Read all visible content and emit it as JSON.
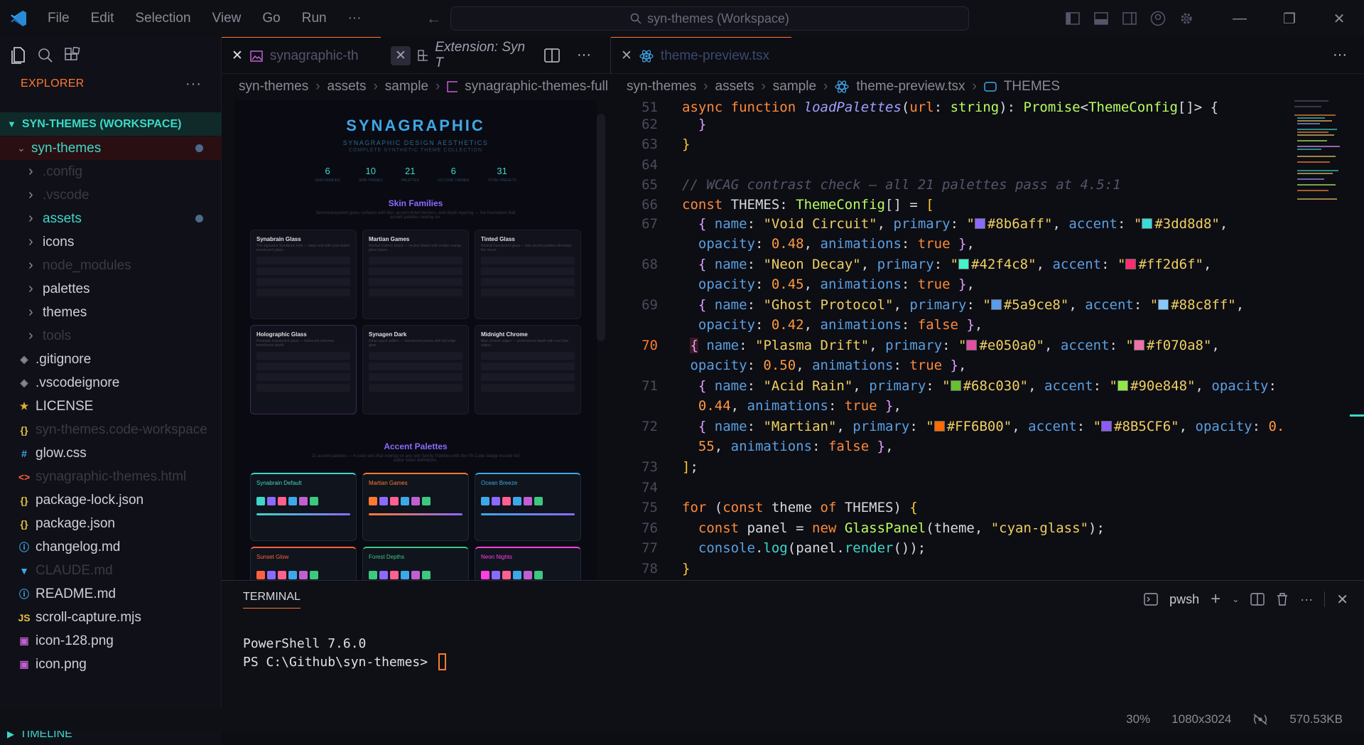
{
  "titlebar": {
    "menu": [
      "File",
      "Edit",
      "Selection",
      "View",
      "Go",
      "Run",
      "···"
    ],
    "search": "syn-themes (Workspace)"
  },
  "sidebar": {
    "title": "EXPLORER",
    "workspace": "SYN-THEMES (WORKSPACE)",
    "root": "syn-themes",
    "items": [
      {
        "label": ".config",
        "kind": "folder",
        "dim": true
      },
      {
        "label": ".vscode",
        "kind": "folder",
        "dim": true
      },
      {
        "label": "assets",
        "kind": "folder",
        "dim": false,
        "color": "#3dd8c8"
      },
      {
        "label": "icons",
        "kind": "folder",
        "dim": false
      },
      {
        "label": "node_modules",
        "kind": "folder",
        "dim": true
      },
      {
        "label": "palettes",
        "kind": "folder",
        "dim": false
      },
      {
        "label": "themes",
        "kind": "folder",
        "dim": false
      },
      {
        "label": "tools",
        "kind": "folder",
        "dim": true
      },
      {
        "label": ".gitignore",
        "kind": "file",
        "dim": false
      },
      {
        "label": ".vscodeignore",
        "kind": "file",
        "dim": false
      },
      {
        "label": "LICENSE",
        "kind": "file",
        "dim": false
      },
      {
        "label": "syn-themes.code-workspace",
        "kind": "file",
        "dim": true
      },
      {
        "label": "glow.css",
        "kind": "file",
        "dim": false
      },
      {
        "label": "synagraphic-themes.html",
        "kind": "file",
        "dim": true
      },
      {
        "label": "package-lock.json",
        "kind": "file",
        "dim": false
      },
      {
        "label": "package.json",
        "kind": "file",
        "dim": false
      },
      {
        "label": "changelog.md",
        "kind": "file",
        "dim": false
      },
      {
        "label": "CLAUDE.md",
        "kind": "file",
        "dim": true
      },
      {
        "label": "README.md",
        "kind": "file",
        "dim": false
      },
      {
        "label": "scroll-capture.mjs",
        "kind": "file",
        "dim": false
      },
      {
        "label": "icon-128.png",
        "kind": "file",
        "dim": false
      },
      {
        "label": "icon.png",
        "kind": "file",
        "dim": false
      }
    ],
    "timeline": "TIMELINE"
  },
  "editor1": {
    "tabs": [
      "synagraphic-th",
      "Extension: Syn T"
    ],
    "crumbs": [
      "syn-themes",
      "assets",
      "sample",
      "synagraphic-themes-full"
    ]
  },
  "preview": {
    "title": "SYNAGRAPHIC",
    "subtitle": "SYNAGRAPHIC DESIGN AESTHETICS",
    "tagline": "COMPLETE SYNTHETIC THEME COLLECTION",
    "stats": [
      {
        "n": "6",
        "l": "SKIN FAMILIES"
      },
      {
        "n": "10",
        "l": "SKIN THEMES"
      },
      {
        "n": "21",
        "l": "PALETTES"
      },
      {
        "n": "6",
        "l": "VS CODE THEMES"
      },
      {
        "n": "31",
        "l": "TOTAL PRESETS"
      }
    ],
    "skin_heading": "Skin Families",
    "skin_desc": "Semi-transparent glass surfaces with blur, accent-tinted borders, and depth layering — the foundation that accent palettes overlay on.",
    "skins": [
      {
        "name": "Synabrain Glass",
        "desc": "The signature Synabrain look — deep void with cyan-tinted translucent glass."
      },
      {
        "name": "Martian Games",
        "desc": "Martian Games brand — neutral blacks with molten orange glass layers."
      },
      {
        "name": "Tinted Glass",
        "desc": "Neutral translucent glass — lets accent palettes dominate the mood."
      },
      {
        "name": "Holographic Glass",
        "desc": "Prismatic translucent glass — iridescent shimmer, translucent depth."
      },
      {
        "name": "Synagen Dark",
        "desc": "Deep space edition — translucent panels with fad edge glow."
      },
      {
        "name": "Midnight Chrome",
        "desc": "Blue chrome edges — professional depth with cool blue edges."
      }
    ],
    "accent_heading": "Accent Palettes",
    "accent_desc": "21 accent palettes — 4-color sets that overlay on any skin family. Palettes with the VS Code badge include full editor token definitions.",
    "palettes": [
      {
        "name": "Synabrain Default",
        "c": "#3dd8c8"
      },
      {
        "name": "Martian Games",
        "c": "#ff7a30"
      },
      {
        "name": "Ocean Breeze",
        "c": "#3da8e8"
      },
      {
        "name": "Sunset Glow",
        "c": "#ff6040"
      },
      {
        "name": "Forest Depths",
        "c": "#3dc880"
      },
      {
        "name": "Neon Nights",
        "c": "#ff40e0"
      }
    ]
  },
  "editor2": {
    "tab": "theme-preview.tsx",
    "crumbs": [
      "syn-themes",
      "assets",
      "sample",
      "theme-preview.tsx",
      "THEMES"
    ]
  },
  "code": {
    "line_numbers": [
      "51",
      "62",
      "63",
      "64",
      "65",
      "66",
      "67",
      "",
      "68",
      "",
      "69",
      "",
      "70",
      "",
      "71",
      "",
      "72",
      "",
      "73",
      "74",
      "75",
      "76",
      "77",
      "78"
    ]
  },
  "panel": {
    "tab": "TERMINAL",
    "shell": "pwsh",
    "lines": [
      "PowerShell 7.6.0",
      "PS C:\\Github\\syn-themes> "
    ]
  },
  "status": {
    "zoom": "30%",
    "size": "1080x3024",
    "file_size": "570.53KB"
  }
}
